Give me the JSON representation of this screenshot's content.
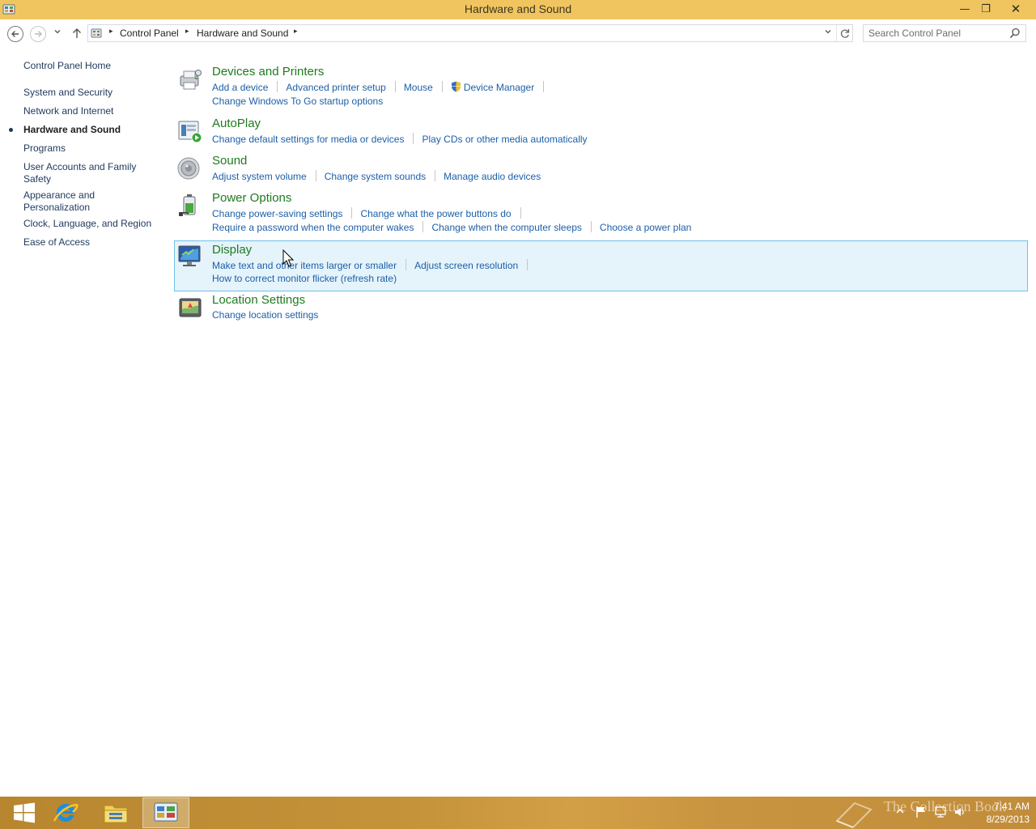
{
  "window": {
    "title": "Hardware and Sound",
    "minimize_glyph": "—",
    "maximize_glyph": "❐",
    "close_glyph": "✕"
  },
  "address": {
    "crumbs": [
      "Control Panel",
      "Hardware and Sound"
    ],
    "search_placeholder": "Search Control Panel"
  },
  "leftnav": {
    "home": "Control Panel Home",
    "items": [
      {
        "label": "System and Security",
        "active": false
      },
      {
        "label": "Network and Internet",
        "active": false
      },
      {
        "label": "Hardware and Sound",
        "active": true
      },
      {
        "label": "Programs",
        "active": false
      },
      {
        "label": "User Accounts and Family Safety",
        "active": false
      },
      {
        "label": "Appearance and Personalization",
        "active": false
      },
      {
        "label": "Clock, Language, and Region",
        "active": false
      },
      {
        "label": "Ease of Access",
        "active": false
      }
    ]
  },
  "categories": [
    {
      "title": "Devices and Printers",
      "icon": "printer-icon",
      "rows": [
        [
          "Add a device",
          "Advanced printer setup",
          "Mouse",
          "Device Manager"
        ],
        [
          "Change Windows To Go startup options"
        ]
      ]
    },
    {
      "title": "AutoPlay",
      "icon": "autoplay-icon",
      "rows": [
        [
          "Change default settings for media or devices",
          "Play CDs or other media automatically"
        ]
      ]
    },
    {
      "title": "Sound",
      "icon": "speaker-icon",
      "rows": [
        [
          "Adjust system volume",
          "Change system sounds",
          "Manage audio devices"
        ]
      ]
    },
    {
      "title": "Power Options",
      "icon": "battery-icon",
      "rows": [
        [
          "Change power-saving settings",
          "Change what the power buttons do"
        ],
        [
          "Require a password when the computer wakes",
          "Change when the computer sleeps",
          "Choose a power plan"
        ]
      ]
    },
    {
      "title": "Display",
      "icon": "monitor-icon",
      "rows": [
        [
          "Make text and other items larger or smaller",
          "Adjust screen resolution"
        ],
        [
          "How to correct monitor flicker (refresh rate)"
        ]
      ]
    },
    {
      "title": "Location Settings",
      "icon": "location-icon",
      "rows": [
        [
          "Change location settings"
        ]
      ]
    }
  ],
  "taskbar": {
    "clock_time": "7:41 AM",
    "clock_date": "8/29/2013",
    "watermark": "The Collection Book"
  },
  "colors": {
    "titlebar": "#f0c560",
    "category_title": "#1e7b1e",
    "task_link": "#1c5fa8",
    "hover_bg": "#e5f3fb",
    "hover_border": "#70c0e7"
  }
}
